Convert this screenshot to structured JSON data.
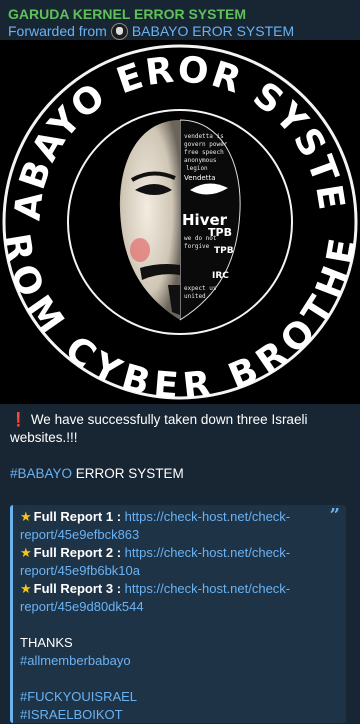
{
  "header": {
    "channel_name": "GARUDA KERNEL ERROR SYSTEM",
    "forwarded_prefix": "Forwarded from",
    "forwarded_source": "BABAYO EROR SYSTEM"
  },
  "image": {
    "top_text": "BABAYO EROR SYSTEM",
    "bottom_text": "FROM CYBER BROTHER",
    "mask_words": [
      "Hiver",
      "TPB",
      "TPB",
      "IRC",
      "Vendetta"
    ]
  },
  "message": {
    "alert_icon": "exclamation-icon",
    "line1": "We have successfully taken down three Israeli websites.!!!",
    "hashtag": "#BABAYO",
    "hashtag_suffix": " ERROR SYSTEM"
  },
  "quote": {
    "reports": [
      {
        "label": "Full Report 1 :",
        "url": "https://check-host.net/check-report/45e9efbck863"
      },
      {
        "label": "Full Report 2 :",
        "url": "https://check-host.net/check-report/45e9fb6bk10a"
      },
      {
        "label": "Full Report 3 :",
        "url": "https://check-host.net/check-report/45e9d80dk544"
      }
    ],
    "thanks": "THANKS",
    "tag1": "#allmemberbabayo",
    "tag2": "#FUCKYOUISRAEL",
    "tag3": "#ISRAELBOIKOT"
  },
  "colors": {
    "background": "#182533",
    "channel_name": "#5fc05a",
    "link": "#6ab3f3",
    "quote_bg": "#1f3347"
  }
}
